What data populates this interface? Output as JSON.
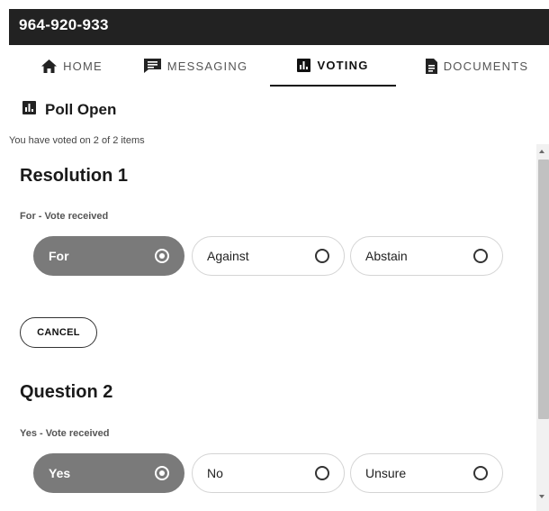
{
  "header": {
    "code": "964-920-933"
  },
  "nav": {
    "tabs": [
      {
        "label": "HOME",
        "icon": "home-icon"
      },
      {
        "label": "MESSAGING",
        "icon": "messaging-icon"
      },
      {
        "label": "VOTING",
        "icon": "voting-icon",
        "active": true
      },
      {
        "label": "DOCUMENTS",
        "icon": "document-icon"
      }
    ]
  },
  "poll": {
    "heading": "Poll Open",
    "voted_summary": "You have voted on 2 of 2 items",
    "cancel_label": "CANCEL",
    "items": [
      {
        "title": "Resolution 1",
        "status": "For - Vote received",
        "options": [
          {
            "label": "For",
            "selected": true
          },
          {
            "label": "Against",
            "selected": false
          },
          {
            "label": "Abstain",
            "selected": false
          }
        ]
      },
      {
        "title": "Question 2",
        "status": "Yes - Vote received",
        "options": [
          {
            "label": "Yes",
            "selected": true
          },
          {
            "label": "No",
            "selected": false
          },
          {
            "label": "Unsure",
            "selected": false
          }
        ]
      }
    ]
  },
  "colors": {
    "topbar": "#222222",
    "selected_option": "#7a7a7a",
    "text": "#1a1a1a"
  }
}
